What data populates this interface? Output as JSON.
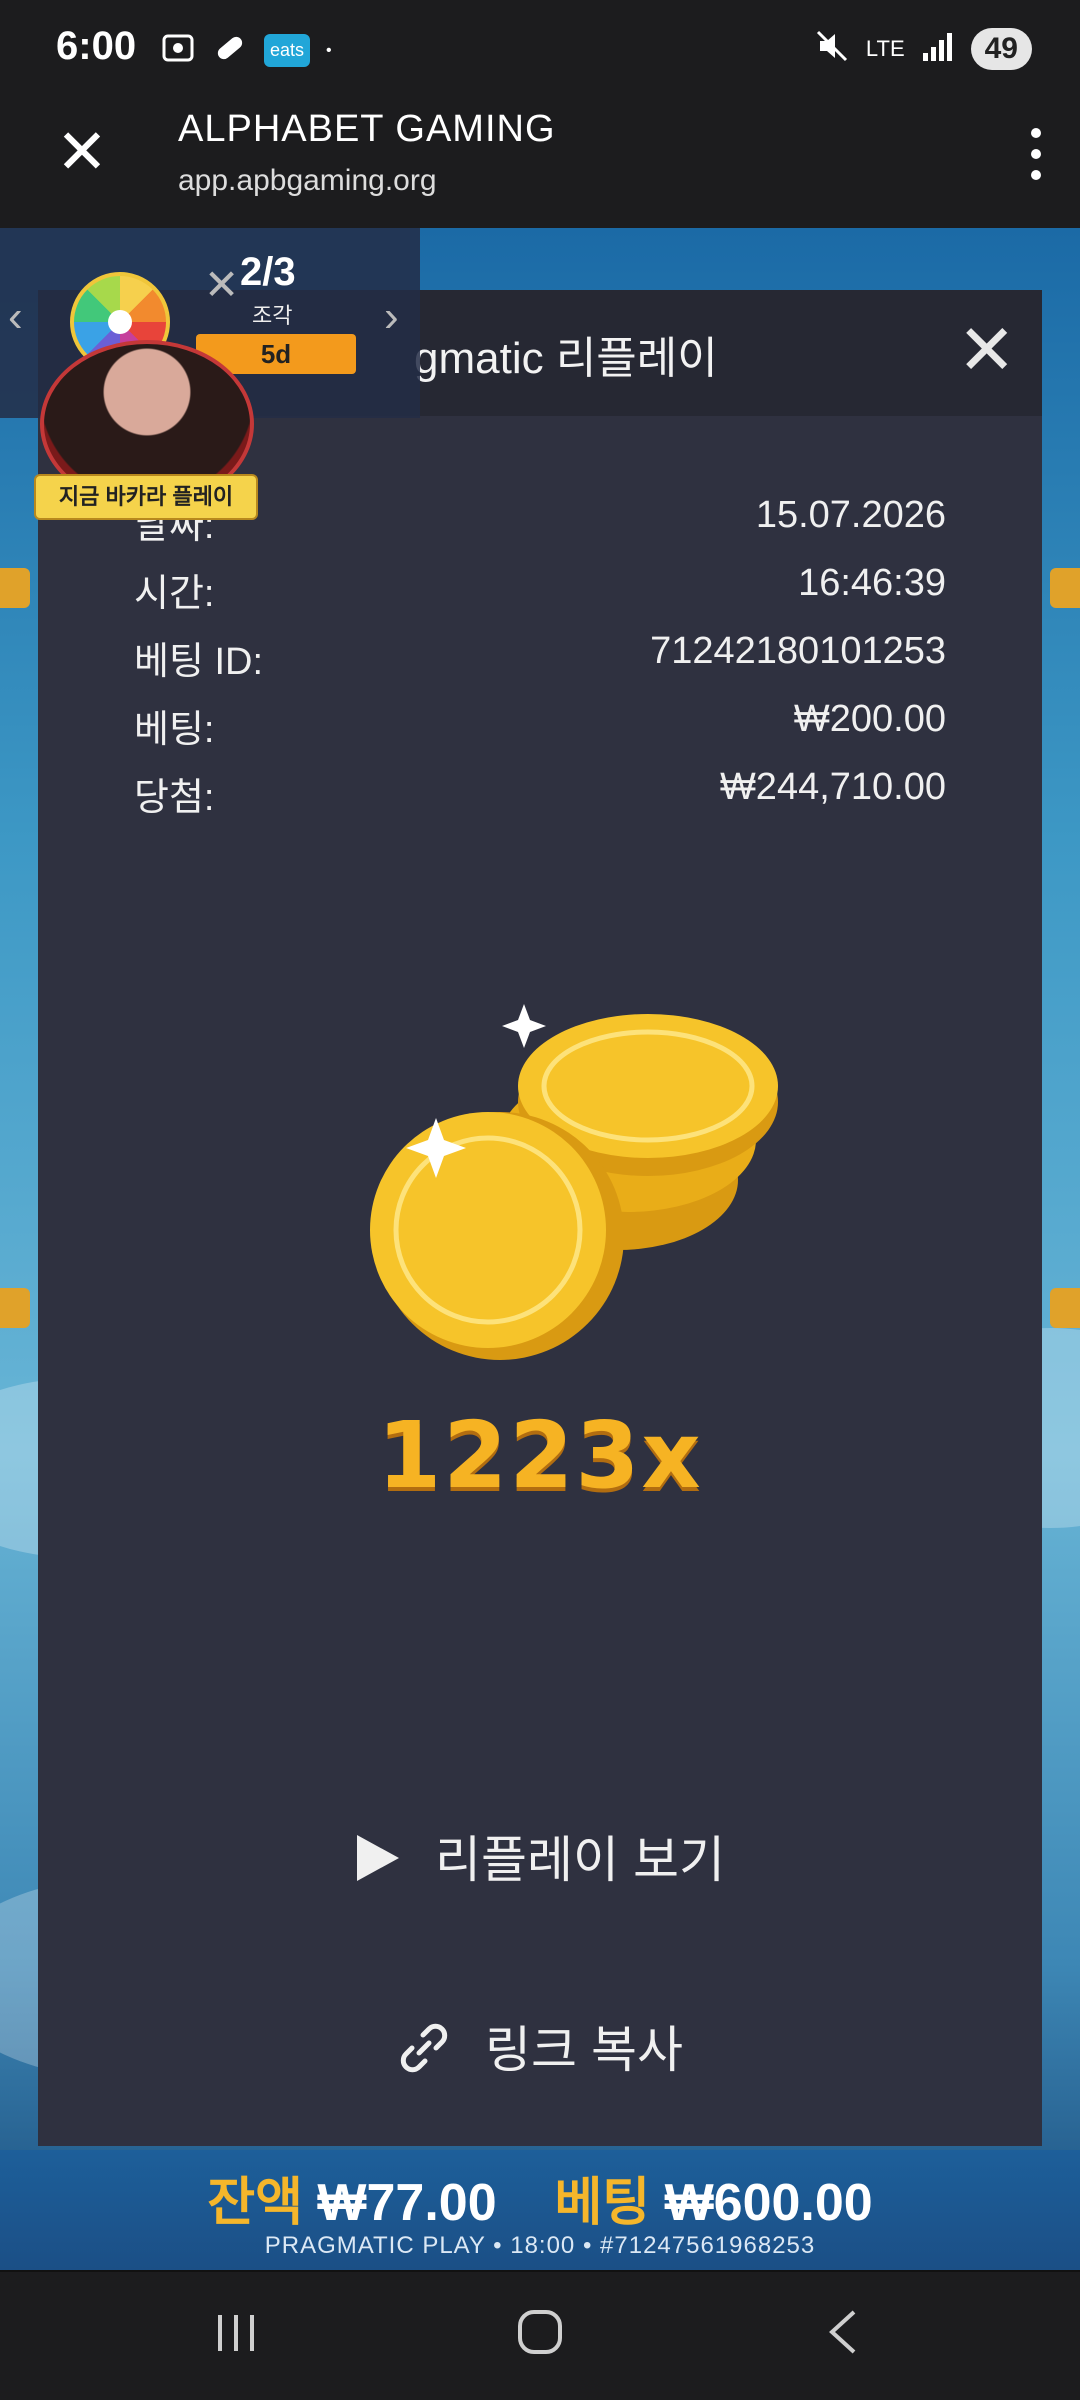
{
  "status": {
    "time": "6:00",
    "eats": "eats",
    "lte": "LTE",
    "battery": "49"
  },
  "browser": {
    "title": "ALPHABET GAMING",
    "url": "app.apbgaming.org"
  },
  "promo": {
    "count": "2/3",
    "sub": "조각",
    "days": "5d",
    "badge": "지금 바카라 플레이"
  },
  "modal": {
    "title": "gmatic 리플레이",
    "rows": [
      {
        "label": "날짜:",
        "value": "15.07.2026"
      },
      {
        "label": "시간:",
        "value": "16:46:39"
      },
      {
        "label": "베팅 ID:",
        "value": "71242180101253"
      },
      {
        "label": "베팅:",
        "value": "₩200.00"
      },
      {
        "label": "당첨:",
        "value": "₩244,710.00"
      }
    ],
    "multiplier": "1223x",
    "replay_label": "리플레이 보기",
    "copy_label": "링크 복사"
  },
  "gamebar": {
    "balance_label": "잔액",
    "balance": "₩77.00",
    "bet_label": "베팅",
    "bet": "₩600.00",
    "footer": "PRAGMATIC PLAY • 18:00 • #71247561968253"
  },
  "colors": {
    "accent": "#f6b323",
    "modal_bg": "#2f3140",
    "badge": "#f39a1c"
  }
}
